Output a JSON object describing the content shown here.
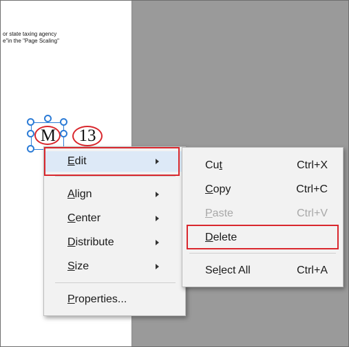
{
  "document": {
    "lines": [
      "or state taxing agency",
      "e\"in the \"Page Scaling\""
    ],
    "fields": [
      "M",
      "13"
    ]
  },
  "context_menu": {
    "items": [
      {
        "label": "Edit",
        "accel": "E",
        "rest": "dit",
        "submenu": true
      },
      {
        "label": "Align",
        "accel": "A",
        "rest": "lign",
        "submenu": true
      },
      {
        "label": "Center",
        "accel": "C",
        "rest": "enter",
        "submenu": true
      },
      {
        "label": "Distribute",
        "accel": "D",
        "rest": "istribute",
        "submenu": true
      },
      {
        "label": "Size",
        "accel": "S",
        "rest": "ize",
        "submenu": true
      },
      {
        "label": "Properties...",
        "accel": "P",
        "rest": "roperties...",
        "submenu": false
      }
    ]
  },
  "edit_submenu": {
    "items": [
      {
        "pre": "Cu",
        "accel": "t",
        "post": "",
        "shortcut": "Ctrl+X",
        "enabled": true
      },
      {
        "pre": "",
        "accel": "C",
        "post": "opy",
        "shortcut": "Ctrl+C",
        "enabled": true
      },
      {
        "pre": "",
        "accel": "P",
        "post": "aste",
        "shortcut": "Ctrl+V",
        "enabled": false
      },
      {
        "pre": "",
        "accel": "D",
        "post": "elete",
        "shortcut": "",
        "enabled": true
      },
      {
        "pre": "Se",
        "accel": "l",
        "post": "ect All",
        "shortcut": "Ctrl+A",
        "enabled": true
      }
    ]
  },
  "colors": {
    "highlight_box": "#d9262c",
    "selection": "#2b7bd6",
    "menu_hover": "#dde9f7"
  }
}
